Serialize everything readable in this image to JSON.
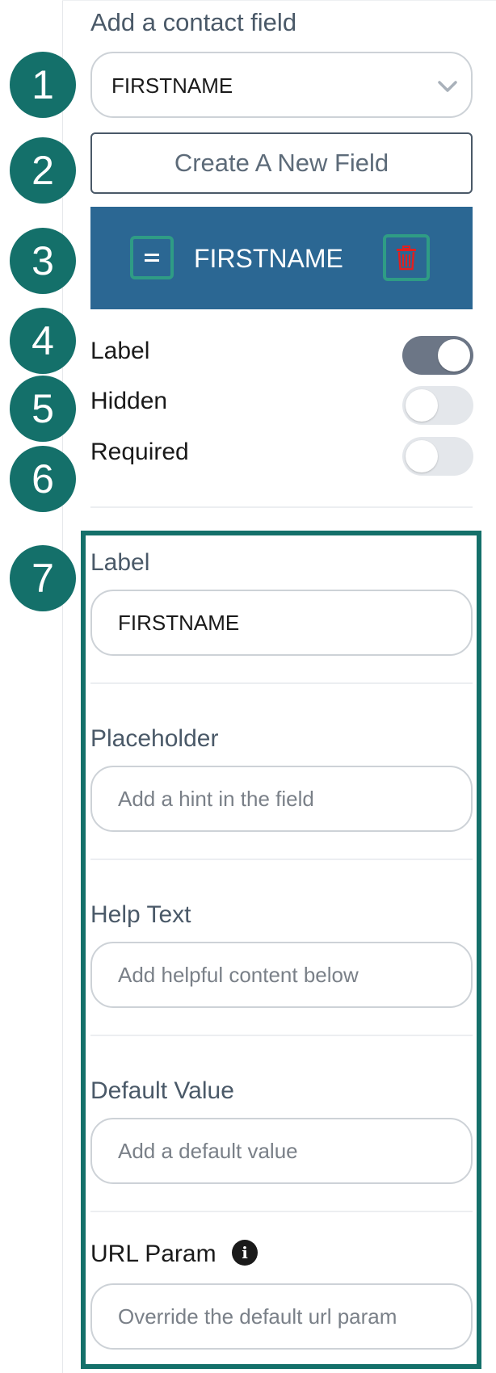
{
  "section_title": "Add a contact field",
  "steps": [
    "1",
    "2",
    "3",
    "4",
    "5",
    "6",
    "7"
  ],
  "field_select": {
    "value": "FIRSTNAME",
    "icon": "chevron-down-icon"
  },
  "create_button": {
    "label": "Create A New Field"
  },
  "selected_field": {
    "name": "FIRSTNAME",
    "drag_icon": "drag-handle-icon",
    "delete_icon": "trash-icon",
    "delete_color": "#e02020",
    "background": "#2b6793"
  },
  "toggles": [
    {
      "label": "Label",
      "on": true
    },
    {
      "label": "Hidden",
      "on": false
    },
    {
      "label": "Required",
      "on": false
    }
  ],
  "settings": {
    "label": {
      "title": "Label",
      "value": "FIRSTNAME",
      "placeholder": ""
    },
    "placeholder": {
      "title": "Placeholder",
      "value": "",
      "placeholder": "Add a hint in the field"
    },
    "help_text": {
      "title": "Help Text",
      "value": "",
      "placeholder": "Add helpful content below"
    },
    "default_value": {
      "title": "Default Value",
      "value": "",
      "placeholder": "Add a default value"
    },
    "url_param": {
      "title": "URL Param",
      "value": "",
      "placeholder": "Override the default url param",
      "icon": "info-icon"
    }
  },
  "colors": {
    "badge": "#14706a",
    "highlight_border": "#14706a",
    "chip_highlight": "#2f9c85",
    "toggle_on": "#6c7686",
    "toggle_off": "#e4e7eb"
  }
}
